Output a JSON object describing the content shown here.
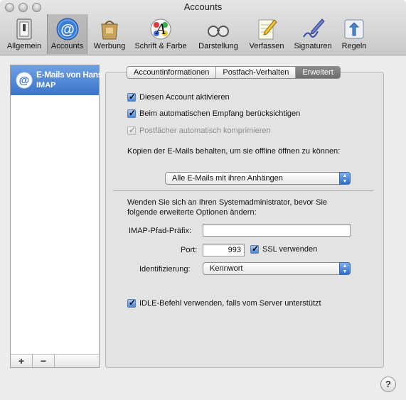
{
  "window": {
    "title": "Accounts"
  },
  "toolbar": {
    "items": [
      {
        "label": "Allgemein",
        "icon": "switch-icon"
      },
      {
        "label": "Accounts",
        "icon": "at-sign-icon",
        "selected": true
      },
      {
        "label": "Werbung",
        "icon": "junk-bag-icon"
      },
      {
        "label": "Schrift & Farbe",
        "icon": "font-palette-icon"
      },
      {
        "label": "Darstellung",
        "icon": "glasses-icon"
      },
      {
        "label": "Verfassen",
        "icon": "pencil-paper-icon"
      },
      {
        "label": "Signaturen",
        "icon": "signature-pen-icon"
      },
      {
        "label": "Regeln",
        "icon": "rules-arrows-icon"
      }
    ]
  },
  "sidebar": {
    "accounts": [
      {
        "name": "E-Mails von Hans",
        "type": "IMAP"
      }
    ],
    "add_label": "+",
    "remove_label": "−"
  },
  "tabs": [
    {
      "label": "Accountinformationen"
    },
    {
      "label": "Postfach-Verhalten"
    },
    {
      "label": "Erweitert",
      "active": true
    }
  ],
  "options": {
    "activate_account": "Diesen Account aktivieren",
    "include_auto_fetch": "Beim automatischen Empfang berücksichtigen",
    "compact_mailboxes": "Postfächer automatisch komprimieren",
    "copies_label": "Kopien der E-Mails behalten, um sie offline öffnen zu können:",
    "copies_value": "Alle E-Mails mit ihren Anhängen"
  },
  "advanced": {
    "warning": "Wenden Sie sich an Ihren Systemadministrator, bevor Sie",
    "warning_line2": "folgende erweiterte Optionen ändern:",
    "imap_prefix_label": "IMAP-Pfad-Präfix:",
    "imap_prefix_value": "",
    "port_label": "Port:",
    "port_value": "993",
    "ssl_label": "SSL verwenden",
    "auth_label": "Identifizierung:",
    "auth_value": "Kennwort",
    "idle_label": "IDLE-Befehl verwenden, falls vom Server unterstützt"
  },
  "help": {
    "label": "?"
  },
  "colors": {
    "selection": "#3a73c9",
    "checkbox": "#4f86d4",
    "popup_arrow": "#2f6cc7"
  }
}
